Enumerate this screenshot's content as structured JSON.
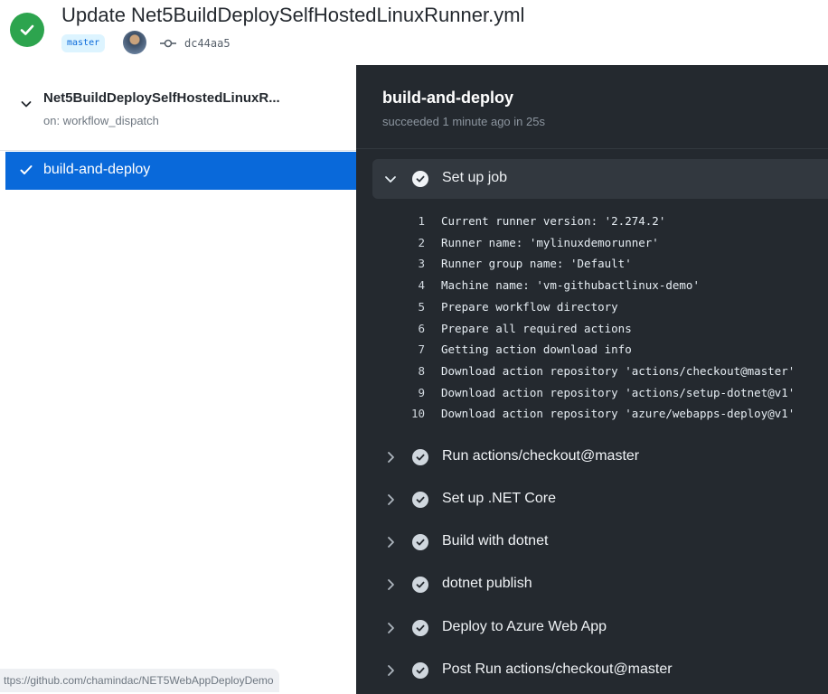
{
  "header": {
    "title": "Update Net5BuildDeploySelfHostedLinuxRunner.yml",
    "branch": "master",
    "commit_sha": "dc44aa5"
  },
  "sidebar": {
    "workflow_name": "Net5BuildDeploySelfHostedLinuxR...",
    "workflow_trigger": "on: workflow_dispatch",
    "jobs": [
      {
        "label": "build-and-deploy",
        "selected": true
      }
    ]
  },
  "status_bar_url": "ttps://github.com/chamindac/NET5WebAppDeployDemo",
  "log_panel": {
    "job_title": "build-and-deploy",
    "job_status": "succeeded 1 minute ago in 25s",
    "steps": [
      {
        "label": "Set up job",
        "expanded": true
      },
      {
        "label": "Run actions/checkout@master",
        "expanded": false
      },
      {
        "label": "Set up .NET Core",
        "expanded": false
      },
      {
        "label": "Build with dotnet",
        "expanded": false
      },
      {
        "label": "dotnet publish",
        "expanded": false
      },
      {
        "label": "Deploy to Azure Web App",
        "expanded": false
      },
      {
        "label": "Post Run actions/checkout@master",
        "expanded": false
      }
    ],
    "log_lines": [
      {
        "num": "1",
        "text": "Current runner version: '2.274.2'"
      },
      {
        "num": "2",
        "text": "Runner name: 'mylinuxdemorunner'"
      },
      {
        "num": "3",
        "text": "Runner group name: 'Default'"
      },
      {
        "num": "4",
        "text": "Machine name: 'vm-githubactlinux-demo'"
      },
      {
        "num": "5",
        "text": "Prepare workflow directory"
      },
      {
        "num": "6",
        "text": "Prepare all required actions"
      },
      {
        "num": "7",
        "text": "Getting action download info"
      },
      {
        "num": "8",
        "text": "Download action repository 'actions/checkout@master'"
      },
      {
        "num": "9",
        "text": "Download action repository 'actions/setup-dotnet@v1'"
      },
      {
        "num": "10",
        "text": "Download action repository 'azure/webapps-deploy@v1'"
      }
    ]
  },
  "colors": {
    "success": "#2da44e",
    "selected_job": "#0969da",
    "log_background": "#24292f",
    "step_check": "#d0d7de"
  },
  "icons": {
    "status": "check-circle-icon",
    "commit": "git-commit-icon",
    "expand": "chevron-down-icon",
    "collapse": "chevron-right-icon"
  }
}
